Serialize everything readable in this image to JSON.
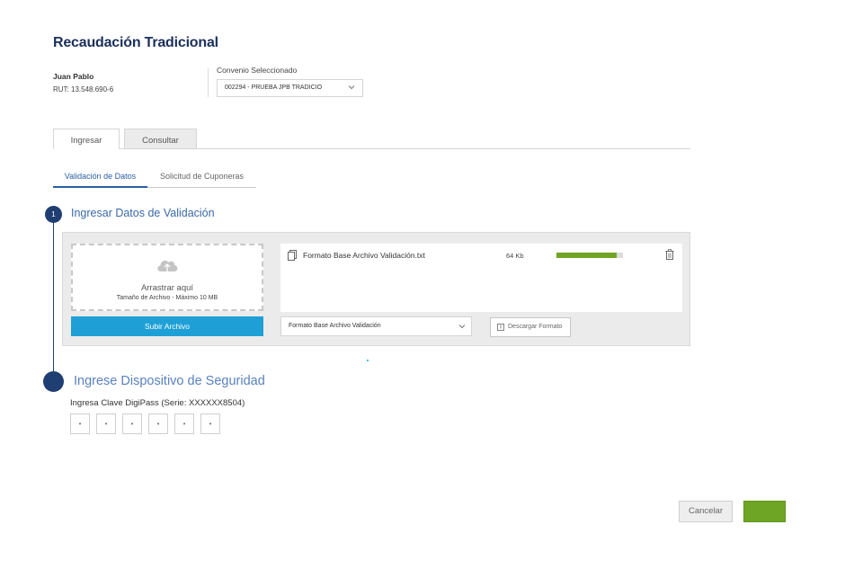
{
  "header": {
    "title": "Recaudación Tradicional",
    "user_name": "Juan Pablo",
    "user_rut": "RUT: 13.548.690-6",
    "convenio_label": "Convenio Seleccionado",
    "convenio_value": "002294 - PRUEBA JPB TRADICIO"
  },
  "tabs": [
    {
      "label": "Ingresar",
      "active": true
    },
    {
      "label": "Consultar",
      "active": false
    }
  ],
  "subtabs": [
    {
      "label": "Validación de Datos",
      "active": true
    },
    {
      "label": "Solicitud de Cuponeras",
      "active": false
    }
  ],
  "step1": {
    "number": "1",
    "title": "Ingresar Datos de Validación",
    "dropzone": {
      "icon": "cloud-upload-icon",
      "title": "Arrastrar aquí",
      "subtitle": "Tamaño de Archivo - Máximo 10 MB"
    },
    "upload_button": "Subir Archivo",
    "file": {
      "icon": "document-icon",
      "name": "Formato Base Archivo Validación.txt",
      "size": "64 Kb",
      "progress_percent": 90,
      "delete_icon": "trash-icon"
    },
    "format_select": "Formato Base Archivo Validación",
    "download_button": "Descargar Formato"
  },
  "step2": {
    "title": "Ingrese Dispositivo de Seguridad",
    "digipass_label": "Ingresa Clave DigiPass (Serie: XXXXXX8504)",
    "pin_fields": [
      "•",
      "•",
      "•",
      "•",
      "•",
      "•"
    ]
  },
  "footer": {
    "cancel_label": "Cancelar",
    "confirm_label": ""
  },
  "colors": {
    "brand_navy": "#1f3e72",
    "link_blue": "#2a5fa3",
    "upload_blue": "#1ea0d7",
    "success_green": "#6ea524"
  }
}
